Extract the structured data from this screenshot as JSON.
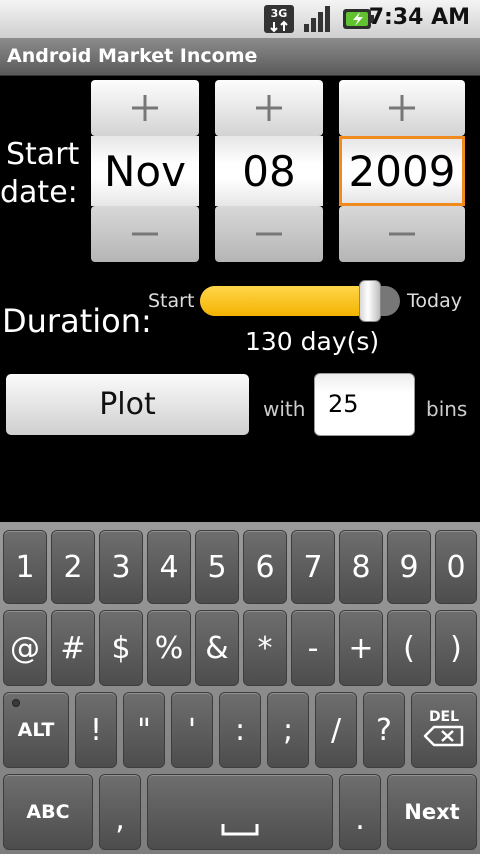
{
  "status_bar": {
    "network": "3G",
    "time": "7:34 AM",
    "icons": [
      "3g-data-icon",
      "signal-strength-icon",
      "battery-charging-icon"
    ]
  },
  "app": {
    "title": "Android Market Income"
  },
  "start_date": {
    "label_line1": "Start",
    "label_line2": "date:",
    "month": "Nov",
    "day": "08",
    "year": "2009",
    "increment_symbol": "+",
    "decrement_symbol": "−"
  },
  "duration": {
    "label": "Duration:",
    "slider_start_label": "Start",
    "slider_end_label": "Today",
    "value_text": "130 day(s)",
    "slider_fraction": 0.85
  },
  "plot": {
    "button_label": "Plot",
    "with_label": "with",
    "bins_value": "25",
    "bins_label": "bins"
  },
  "keyboard": {
    "row1": [
      "1",
      "2",
      "3",
      "4",
      "5",
      "6",
      "7",
      "8",
      "9",
      "0"
    ],
    "row2": [
      "@",
      "#",
      "$",
      "%",
      "&",
      "*",
      "-",
      "+",
      "(",
      ")"
    ],
    "row3": [
      "ALT",
      "!",
      "\"",
      "'",
      ":",
      ";",
      "/",
      "?"
    ],
    "del_label": "DEL",
    "abc_label": "ABC",
    "comma": ",",
    "period": ".",
    "next_label": "Next"
  },
  "colors": {
    "accent_focus": "#f08a1d",
    "slider_fill": "#f3b300",
    "background": "#000000"
  }
}
